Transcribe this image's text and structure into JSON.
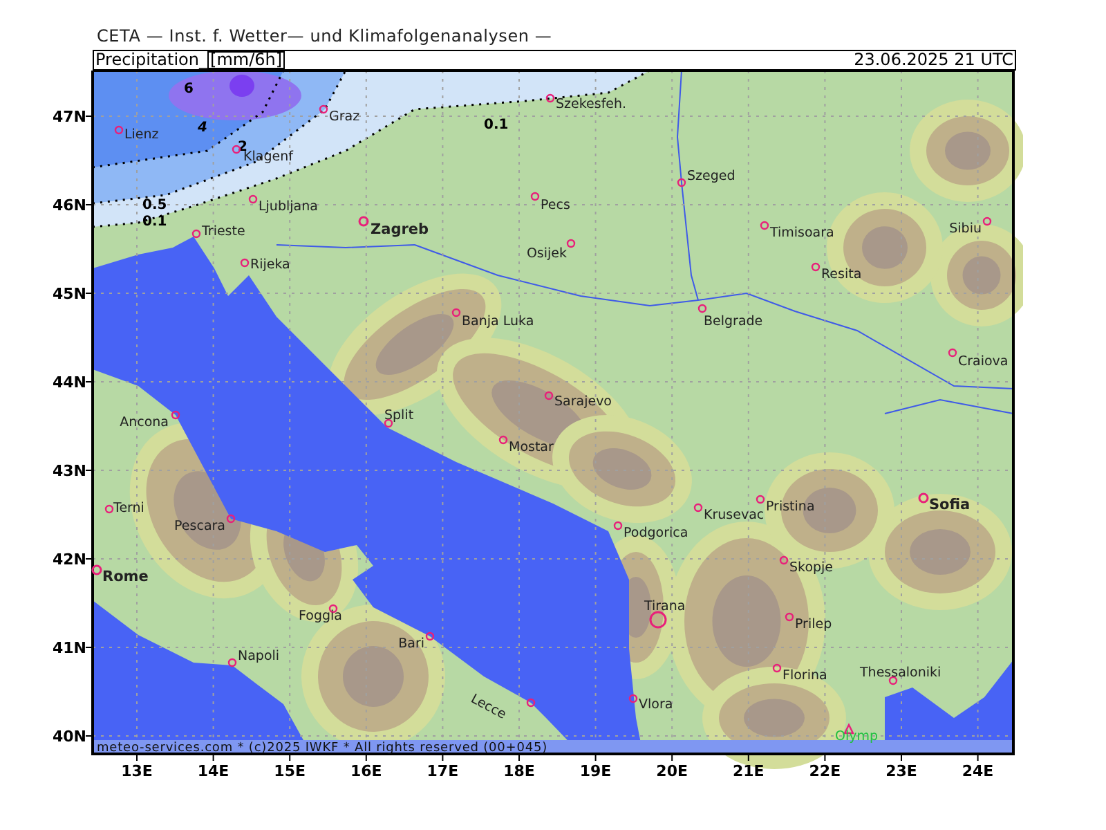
{
  "header": {
    "title": "CETA — Inst. f. Wetter— und Klimafolgenanalysen —"
  },
  "map": {
    "variable": "Precipitation_",
    "unit": "[mm/6h]",
    "valid_time": "23.06.2025 21 UTC",
    "contour_labels": [
      "6",
      "4",
      "2",
      "0.5",
      "0.1",
      "0.1"
    ],
    "cities": [
      {
        "name": "Lienz",
        "kind": "town"
      },
      {
        "name": "Klagenf",
        "kind": "town"
      },
      {
        "name": "Graz",
        "kind": "town"
      },
      {
        "name": "Szekesfeh.",
        "kind": "town"
      },
      {
        "name": "Ljubljana",
        "kind": "town"
      },
      {
        "name": "Trieste",
        "kind": "town"
      },
      {
        "name": "Zagreb",
        "kind": "city"
      },
      {
        "name": "Rijeka",
        "kind": "town"
      },
      {
        "name": "Pecs",
        "kind": "town"
      },
      {
        "name": "Osijek",
        "kind": "town"
      },
      {
        "name": "Szeged",
        "kind": "town"
      },
      {
        "name": "Timisoara",
        "kind": "town"
      },
      {
        "name": "Resita",
        "kind": "town"
      },
      {
        "name": "Sibiu",
        "kind": "town"
      },
      {
        "name": "Craiova",
        "kind": "town"
      },
      {
        "name": "Belgrade",
        "kind": "town"
      },
      {
        "name": "Banja Luka",
        "kind": "town"
      },
      {
        "name": "Sarajevo",
        "kind": "town"
      },
      {
        "name": "Ancona",
        "kind": "town"
      },
      {
        "name": "Split",
        "kind": "town"
      },
      {
        "name": "Mostar",
        "kind": "town"
      },
      {
        "name": "Terni",
        "kind": "town"
      },
      {
        "name": "Pescara",
        "kind": "town"
      },
      {
        "name": "Rome",
        "kind": "city"
      },
      {
        "name": "Foggia",
        "kind": "town"
      },
      {
        "name": "Bari",
        "kind": "town"
      },
      {
        "name": "Napoli",
        "kind": "town"
      },
      {
        "name": "Lecce",
        "kind": "town"
      },
      {
        "name": "Podgorica",
        "kind": "town"
      },
      {
        "name": "Krusevac",
        "kind": "town"
      },
      {
        "name": "Pristina",
        "kind": "town"
      },
      {
        "name": "Sofia",
        "kind": "city"
      },
      {
        "name": "Skopje",
        "kind": "town"
      },
      {
        "name": "Tirana",
        "kind": "capital"
      },
      {
        "name": "Prilep",
        "kind": "town"
      },
      {
        "name": "Florina",
        "kind": "town"
      },
      {
        "name": "Thessaloniki",
        "kind": "town"
      },
      {
        "name": "Vlora",
        "kind": "town"
      },
      {
        "name": "Olymp",
        "kind": "peak"
      }
    ],
    "latitude_labels": [
      "47N",
      "46N",
      "45N",
      "44N",
      "43N",
      "42N",
      "41N",
      "40N"
    ],
    "longitude_labels": [
      "13E",
      "14E",
      "15E",
      "16E",
      "17E",
      "18E",
      "19E",
      "20E",
      "21E",
      "22E",
      "23E",
      "24E"
    ],
    "footer": "meteo-services.com * (c)2025 IWKF * All rights reserved (00+045)"
  }
}
